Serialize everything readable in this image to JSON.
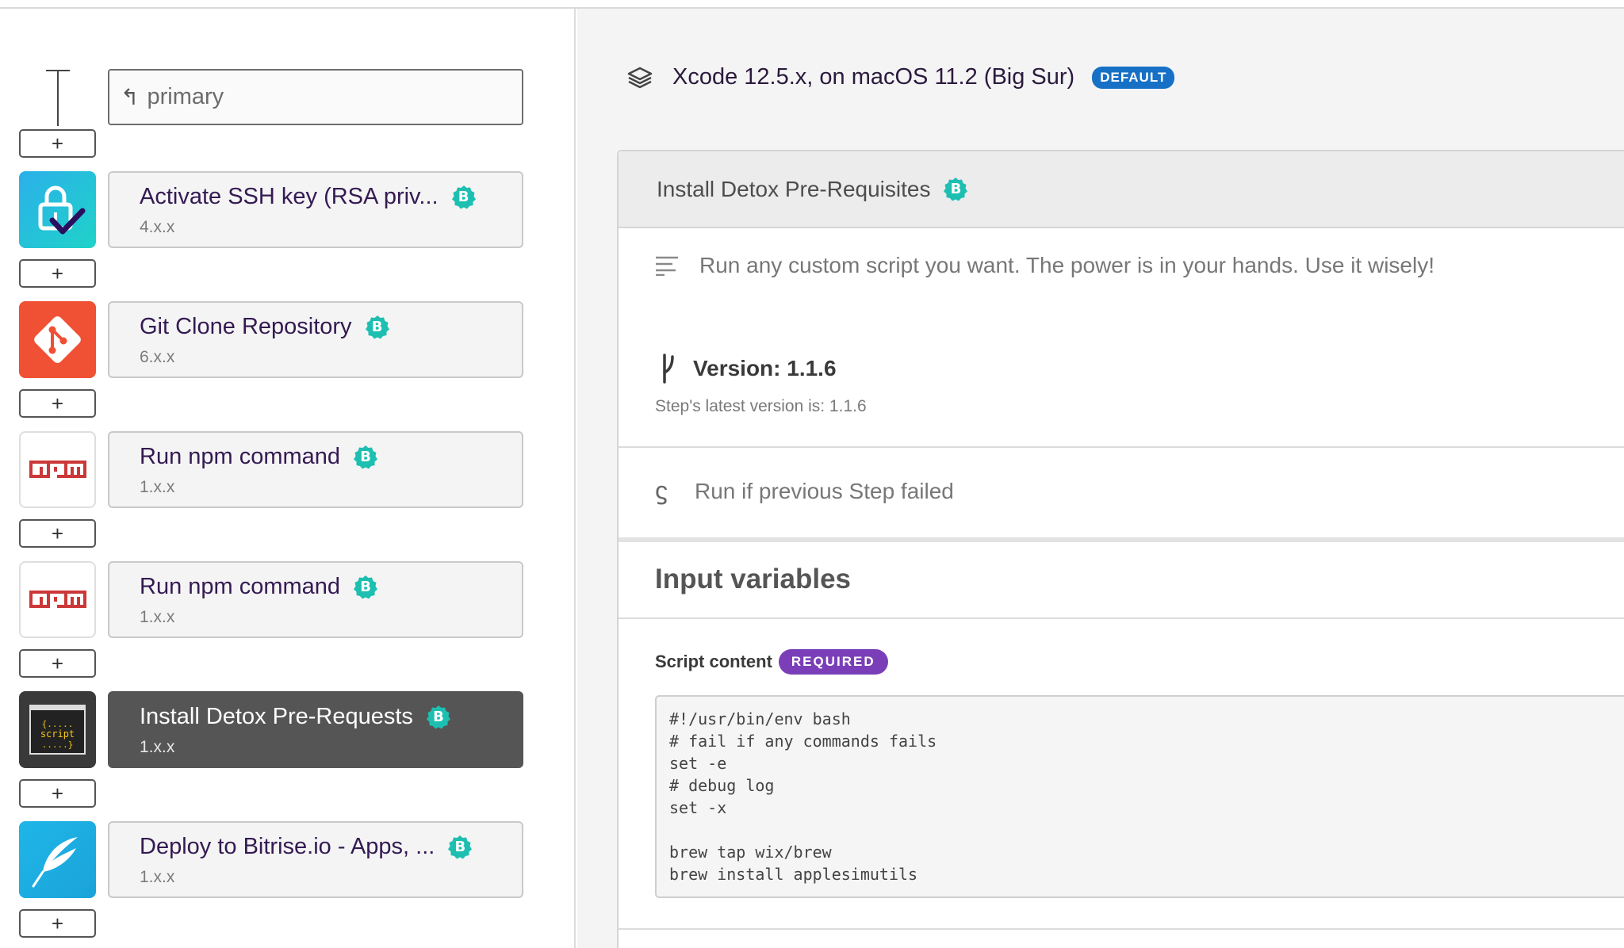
{
  "workflow": {
    "selected": "primary"
  },
  "add_label": "+",
  "steps": [
    {
      "title": "Activate SSH key (RSA priv...",
      "version": "4.x.x",
      "icon": "lock-check-icon",
      "badge": "B"
    },
    {
      "title": "Git Clone Repository",
      "version": "6.x.x",
      "icon": "git-icon",
      "badge": "B"
    },
    {
      "title": "Run npm command",
      "version": "1.x.x",
      "icon": "npm-icon",
      "badge": "B"
    },
    {
      "title": "Run npm command",
      "version": "1.x.x",
      "icon": "npm-icon",
      "badge": "B"
    },
    {
      "title": "Install Detox Pre-Requests",
      "version": "1.x.x",
      "icon": "script-icon",
      "badge": "B",
      "active": true
    },
    {
      "title": "Deploy to Bitrise.io - Apps, ...",
      "version": "1.x.x",
      "icon": "feather-icon",
      "badge": "B"
    }
  ],
  "stack": {
    "label": "Xcode 12.5.x, on macOS 11.2 (Big Sur)",
    "badge": "DEFAULT",
    "icon": "layers-icon"
  },
  "detail": {
    "title": "Install Detox Pre-Requisites",
    "badge": "B",
    "description": "Run any custom script you want. The power is in your hands. Use it wisely!",
    "version_label": "Version: 1.1.6",
    "latest_version": "Step's latest version is: 1.1.6",
    "run_if_failed": "Run if previous Step failed",
    "inputs_title": "Input variables",
    "script_label": "Script content",
    "required_badge": "REQUIRED",
    "script_content": "#!/usr/bin/env bash\n# fail if any commands fails\nset -e\n# debug log\nset -x\n\nbrew tap wix/brew\nbrew install applesimutils"
  },
  "colors": {
    "verified_badge": "#1dbfb1",
    "default_badge": "#1570c6",
    "required_badge": "#7a3fb8",
    "active_step": "#555555",
    "git": "#f05033",
    "npm": "#cb3837"
  }
}
